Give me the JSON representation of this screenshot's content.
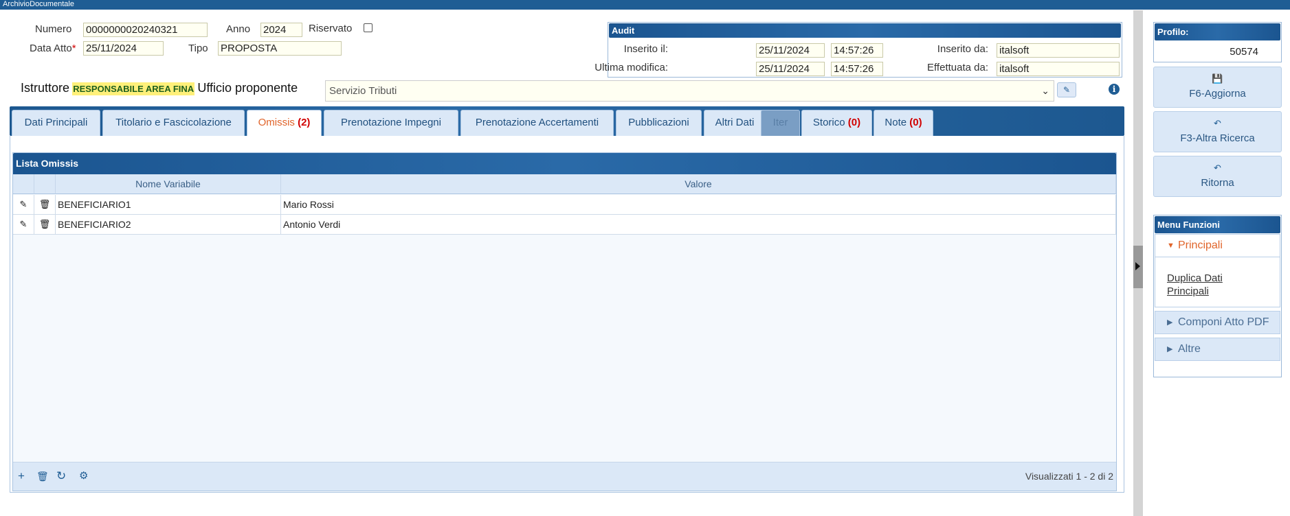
{
  "window": {
    "title": "ArchivioDocumentale"
  },
  "header": {
    "numero_label": "Numero",
    "numero_value": "0000000020240321",
    "anno_label": "Anno",
    "anno_value": "2024",
    "riservato_label": "Riservato",
    "riservato_checked": false,
    "data_atto_label": "Data Atto",
    "data_atto_required": "*",
    "data_atto_value": "25/11/2024",
    "tipo_label": "Tipo",
    "tipo_value": "PROPOSTA",
    "istruttore_label": "Istruttore",
    "istruttore_value": "RESPONSABILE AREA FINA",
    "ufficio_label": "Ufficio proponente",
    "ufficio_value": "Servizio Tributi"
  },
  "audit": {
    "title": "Audit",
    "inserito_il_label": "Inserito il:",
    "inserito_il_date": "25/11/2024",
    "inserito_il_time": "14:57:26",
    "inserito_da_label": "Inserito da:",
    "inserito_da_value": "italsoft",
    "ultima_modifica_label": "Ultima modifica:",
    "ultima_modifica_date": "25/11/2024",
    "ultima_modifica_time": "14:57:26",
    "effettuata_da_label": "Effettuata da:",
    "effettuata_da_value": "italsoft"
  },
  "tabs": [
    {
      "label": "Dati Principali",
      "count": ""
    },
    {
      "label": "Titolario e Fascicolazione",
      "count": ""
    },
    {
      "label": "Omissis",
      "count": "(2)"
    },
    {
      "label": "Prenotazione Impegni",
      "count": ""
    },
    {
      "label": "Prenotazione Accertamenti",
      "count": ""
    },
    {
      "label": "Pubblicazioni",
      "count": ""
    },
    {
      "label": "Altri Dati",
      "count": ""
    },
    {
      "label": "Iter",
      "count": ""
    },
    {
      "label": "Storico",
      "count": "(0)"
    },
    {
      "label": "Note",
      "count": "(0)"
    }
  ],
  "active_tab": "Omissis",
  "grid": {
    "title": "Lista Omissis",
    "columns": [
      "Nome Variabile",
      "Valore"
    ],
    "rows": [
      {
        "nome": "BENEFICIARIO1",
        "valore": "Mario Rossi"
      },
      {
        "nome": "BENEFICIARIO2",
        "valore": "Antonio Verdi"
      }
    ],
    "footer_text": "Visualizzati 1 - 2 di 2"
  },
  "icons": {
    "edit": "pencil-icon",
    "delete": "trash-icon",
    "add": "plus-icon",
    "refresh": "refresh-icon",
    "settings": "gear-icon",
    "info": "info-icon",
    "save": "floppy-icon",
    "back": "undo-arrow-icon"
  },
  "sidebar": {
    "profilo_label": "Profilo:",
    "profilo_value": "50574",
    "actions": [
      {
        "label": "F6-Aggiorna"
      },
      {
        "label": "F3-Altra Ricerca"
      },
      {
        "label": "Ritorna"
      }
    ],
    "menu_title": "Menu Funzioni",
    "menu_sections": [
      {
        "label": "Principali",
        "open": true,
        "items": [
          "Duplica Dati Principali"
        ]
      },
      {
        "label": "Componi Atto PDF",
        "open": false
      },
      {
        "label": "Altre",
        "open": false
      }
    ]
  },
  "colors": {
    "brand_blue": "#1f5d94",
    "active_tab_orange": "#e0642a",
    "field_bg": "#fffff2",
    "highlight_yellow": "#fff07a",
    "count_red": "#d10000"
  }
}
